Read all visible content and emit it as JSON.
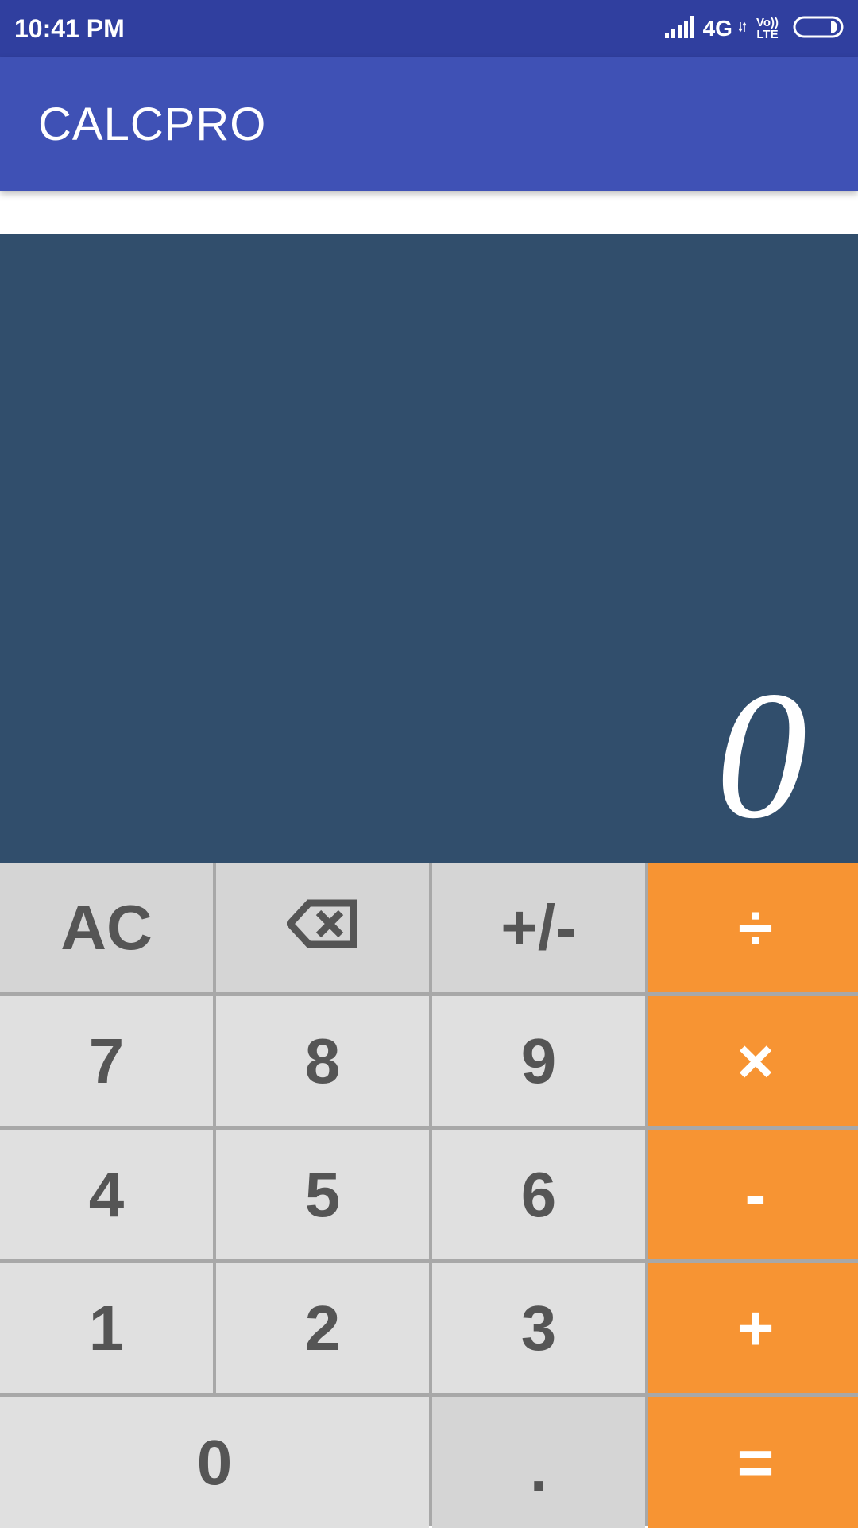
{
  "status_bar": {
    "time": "10:41 PM",
    "network": "4G",
    "volte_top": "Vo))",
    "volte_bottom": "LTE"
  },
  "app_bar": {
    "title": "CALCPRO"
  },
  "display": {
    "value": "0"
  },
  "keys": {
    "clear": "AC",
    "sign": "+/-",
    "divide": "÷",
    "multiply": "×",
    "subtract": "-",
    "add": "+",
    "equals": "=",
    "seven": "7",
    "eight": "8",
    "nine": "9",
    "four": "4",
    "five": "5",
    "six": "6",
    "one": "1",
    "two": "2",
    "three": "3",
    "zero": "0",
    "decimal": "."
  },
  "colors": {
    "status_bar": "#303f9f",
    "app_bar": "#3f51b5",
    "display_bg": "#314e6c",
    "operator_key": "#f79433",
    "digit_key": "#e0e0e0",
    "key_text": "#555555"
  },
  "icons": {
    "backspace": "backspace-icon",
    "signal": "signal-icon",
    "battery": "battery-icon",
    "data_arrows": "data-arrows-icon"
  }
}
